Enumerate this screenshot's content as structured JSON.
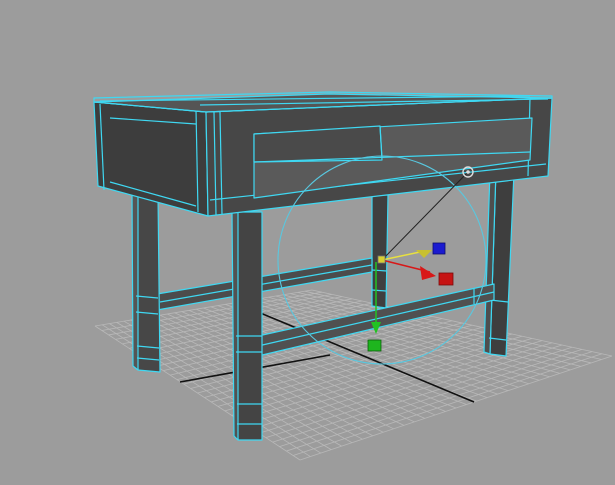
{
  "viewport": {
    "name": "perspective-viewport",
    "colors": {
      "background": "#9c9c9c",
      "grid": "#b8b8b8",
      "grid_axis": "#111111",
      "mesh_face": "#4a4a4a",
      "mesh_face_dark": "#3c3c3c",
      "mesh_face_light": "#5a5a5a",
      "wireframe_selected": "#3fd8f2",
      "manipulator_x": "#d81818",
      "manipulator_y": "#22c322",
      "manipulator_z": "#2020d8",
      "manipulator_center": "#d8d030",
      "rotate_ring": "#58c8e0"
    }
  },
  "selection": {
    "object": "table-mesh",
    "state": "selected"
  },
  "manipulator": {
    "type": "move-rotate",
    "handles": [
      "x-axis-handle",
      "y-axis-handle",
      "z-axis-handle",
      "center-handle",
      "rotate-ring"
    ]
  }
}
